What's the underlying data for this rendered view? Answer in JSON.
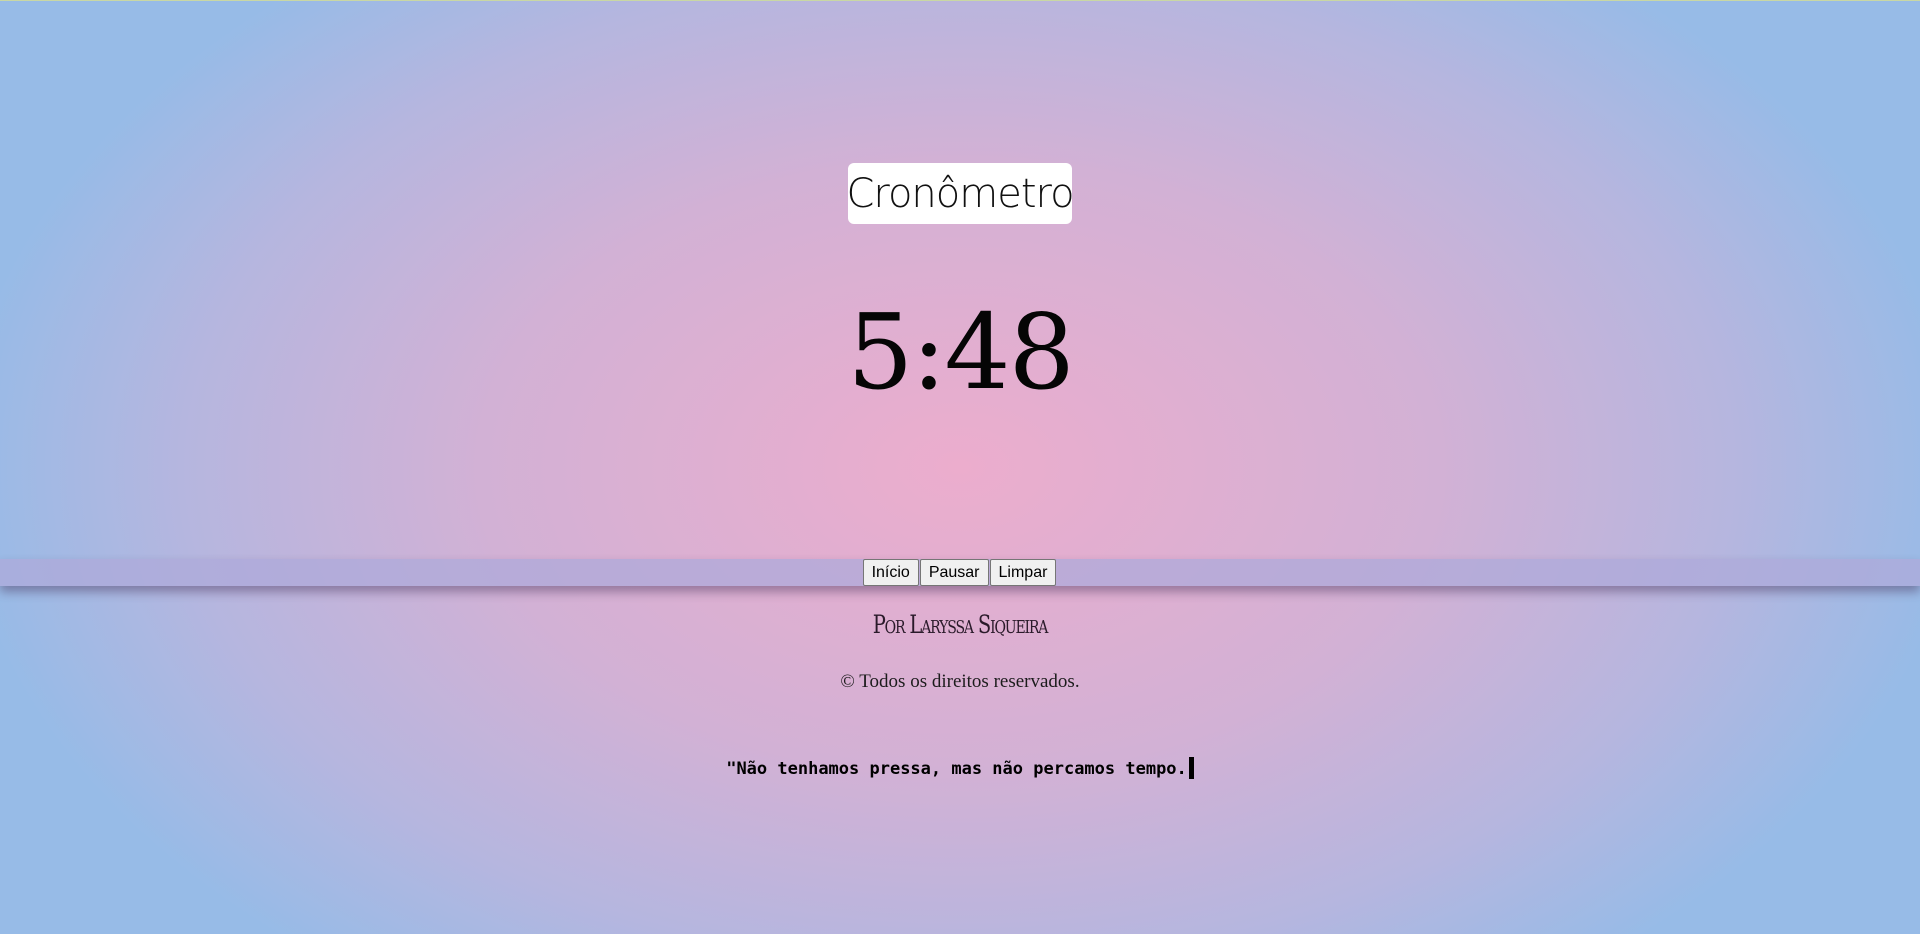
{
  "header": {
    "title": "Cronômetro"
  },
  "timer": {
    "display": "5:48"
  },
  "controls": {
    "start_label": "Início",
    "pause_label": "Pausar",
    "clear_label": "Limpar"
  },
  "footer": {
    "author": "Por Laryssa Siqueira",
    "copyright": "© Todos os direitos reservados.",
    "quote": "\"Não tenhamos pressa, mas não percamos tempo."
  },
  "colors": {
    "background_center": "#ecadcd",
    "background_edge": "#97bbe7",
    "title_box": "#ffffff"
  }
}
